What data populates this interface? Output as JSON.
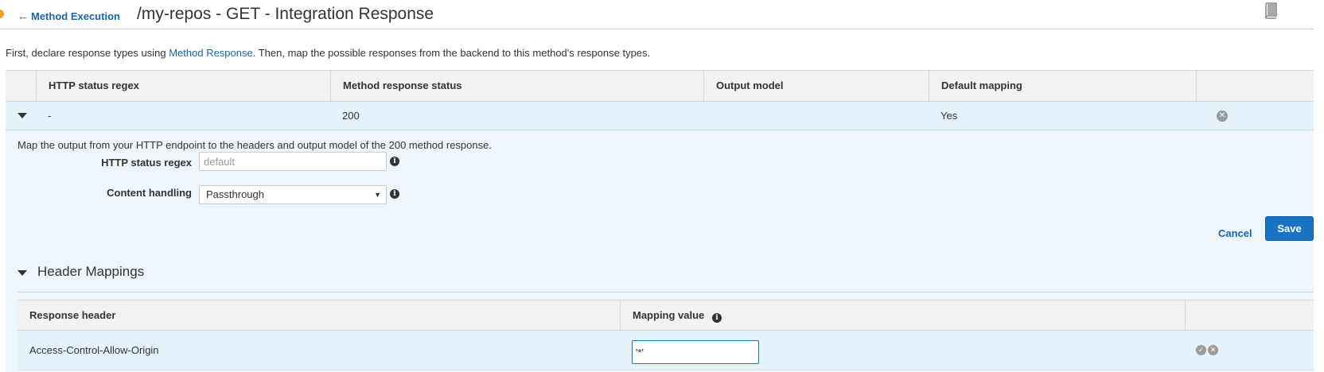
{
  "header": {
    "back_label": "Method Execution",
    "title": "/my-repos - GET - Integration Response",
    "book_icon": "book-icon"
  },
  "intro": {
    "prefix": "First, declare response types using ",
    "link": "Method Response",
    "suffix": ". Then, map the possible responses from the backend to this method's response types."
  },
  "table": {
    "columns": [
      "HTTP status regex",
      "Method response status",
      "Output model",
      "Default mapping"
    ],
    "rows": [
      {
        "regex": "-",
        "status": "200",
        "model": "",
        "default": "Yes"
      }
    ]
  },
  "detail": {
    "description": "Map the output from your HTTP endpoint to the headers and output model of the 200 method response.",
    "regex_label": "HTTP status regex",
    "regex_placeholder": "default",
    "content_label": "Content handling",
    "content_value": "Passthrough",
    "cancel_label": "Cancel",
    "save_label": "Save"
  },
  "header_mappings": {
    "title": "Header Mappings",
    "columns": [
      "Response header",
      "Mapping value"
    ],
    "rows": [
      {
        "header": "Access-Control-Allow-Origin",
        "value": "'*'"
      }
    ]
  },
  "colors": {
    "accent": "#1a66a8",
    "save_button": "#1a73c0",
    "row_highlight": "#e6f2fa",
    "header_bg": "#f2f2f2"
  }
}
